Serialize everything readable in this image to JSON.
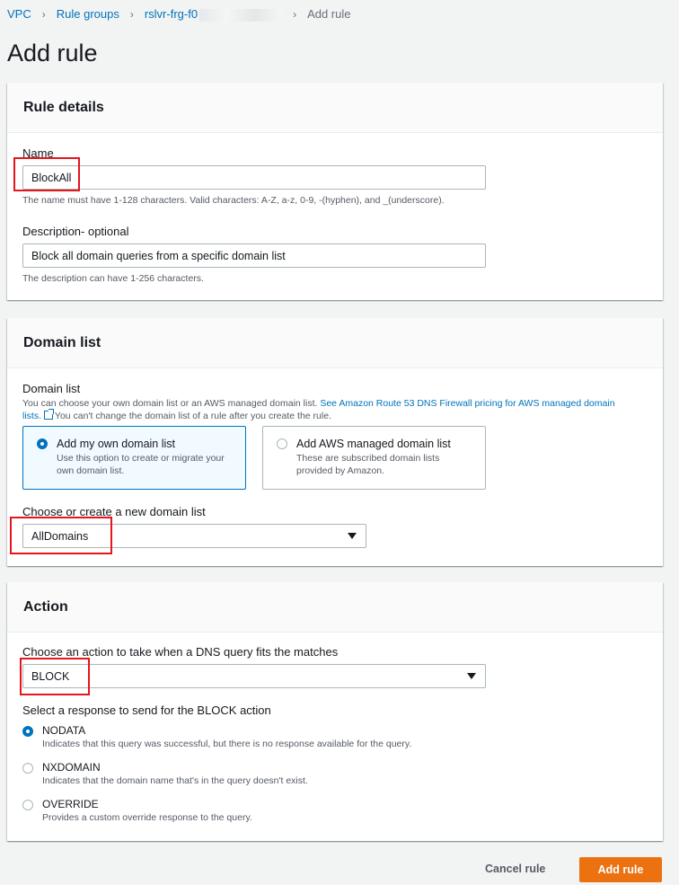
{
  "breadcrumb": {
    "items": [
      "VPC",
      "Rule groups",
      "rslvr-frg-f0"
    ],
    "current": "Add rule",
    "sep": "›"
  },
  "page_title": "Add rule",
  "rule_details": {
    "header": "Rule details",
    "name_label": "Name",
    "name_value": "BlockAll",
    "name_hint": "The name must have 1-128 characters. Valid characters: A-Z, a-z, 0-9, -(hyphen), and _(underscore).",
    "desc_label": "Description- optional",
    "desc_value": "Block all domain queries from a specific domain list",
    "desc_hint": "The description can have 1-256 characters."
  },
  "domain_list": {
    "header": "Domain list",
    "label": "Domain list",
    "info_text": "You can choose your own domain list or an AWS managed domain list.",
    "info_link": "See Amazon Route 53 DNS Firewall pricing for AWS managed domain lists.",
    "info_tail": "You can't change the domain list of a rule after you create the rule.",
    "tiles": [
      {
        "title": "Add my own domain list",
        "desc": "Use this option to create or migrate your own domain list.",
        "selected": true
      },
      {
        "title": "Add AWS managed domain list",
        "desc": "These are subscribed domain lists provided by Amazon.",
        "selected": false
      }
    ],
    "choose_label": "Choose or create a new domain list",
    "choose_value": "AllDomains"
  },
  "action": {
    "header": "Action",
    "choose_label": "Choose an action to take when a DNS query fits the matches",
    "choose_value": "BLOCK",
    "response_label": "Select a response to send for the BLOCK action",
    "options": [
      {
        "title": "NODATA",
        "desc": "Indicates that this query was successful, but there is no response available for the query.",
        "selected": true
      },
      {
        "title": "NXDOMAIN",
        "desc": "Indicates that the domain name that's in the query doesn't exist.",
        "selected": false
      },
      {
        "title": "OVERRIDE",
        "desc": "Provides a custom override response to the query.",
        "selected": false
      }
    ]
  },
  "footer": {
    "cancel_label": "Cancel rule",
    "submit_label": "Add rule"
  },
  "colors": {
    "link": "#0073bb",
    "primary_button": "#ec7211",
    "highlight_box": "#e3161c"
  }
}
